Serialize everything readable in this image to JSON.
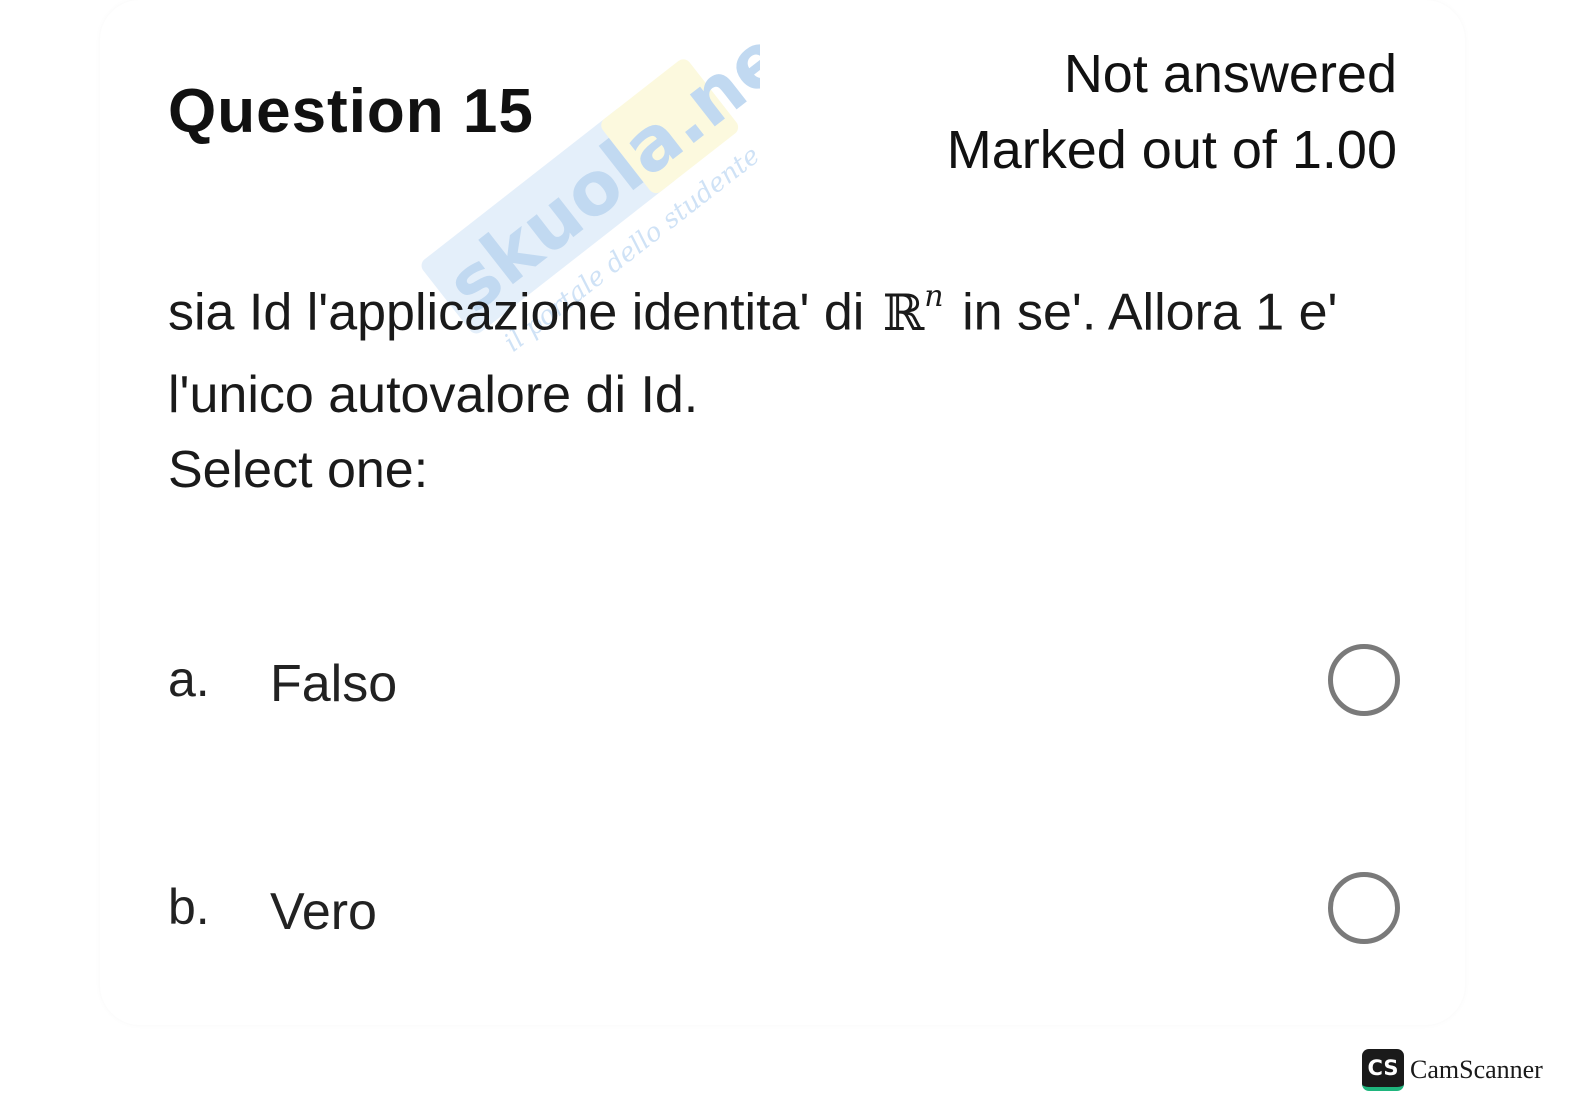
{
  "question": {
    "title": "Question 15",
    "status": "Not answered",
    "mark": "Marked out of 1.00",
    "text_before_math": "sia Id l'applicazione identita' di ",
    "math_symbol": "ℝ",
    "math_exponent": "n",
    "text_after_math": " in se'. Allora 1 e' l'unico autovalore di Id.",
    "prompt": "Select one:"
  },
  "options": [
    {
      "letter": "a.",
      "label": "Falso",
      "selected": false
    },
    {
      "letter": "b.",
      "label": "Vero",
      "selected": false
    }
  ],
  "watermark": {
    "brand": "skuola.net",
    "tagline": "il portale dello studente"
  },
  "footer": {
    "badge": "CS",
    "brand": "CamScanner"
  },
  "colors": {
    "watermark_blue": "#9fc6ec",
    "watermark_yellow": "#f6ee9a",
    "radio_border": "#7a7a7a",
    "cs_green": "#1fb57d"
  }
}
